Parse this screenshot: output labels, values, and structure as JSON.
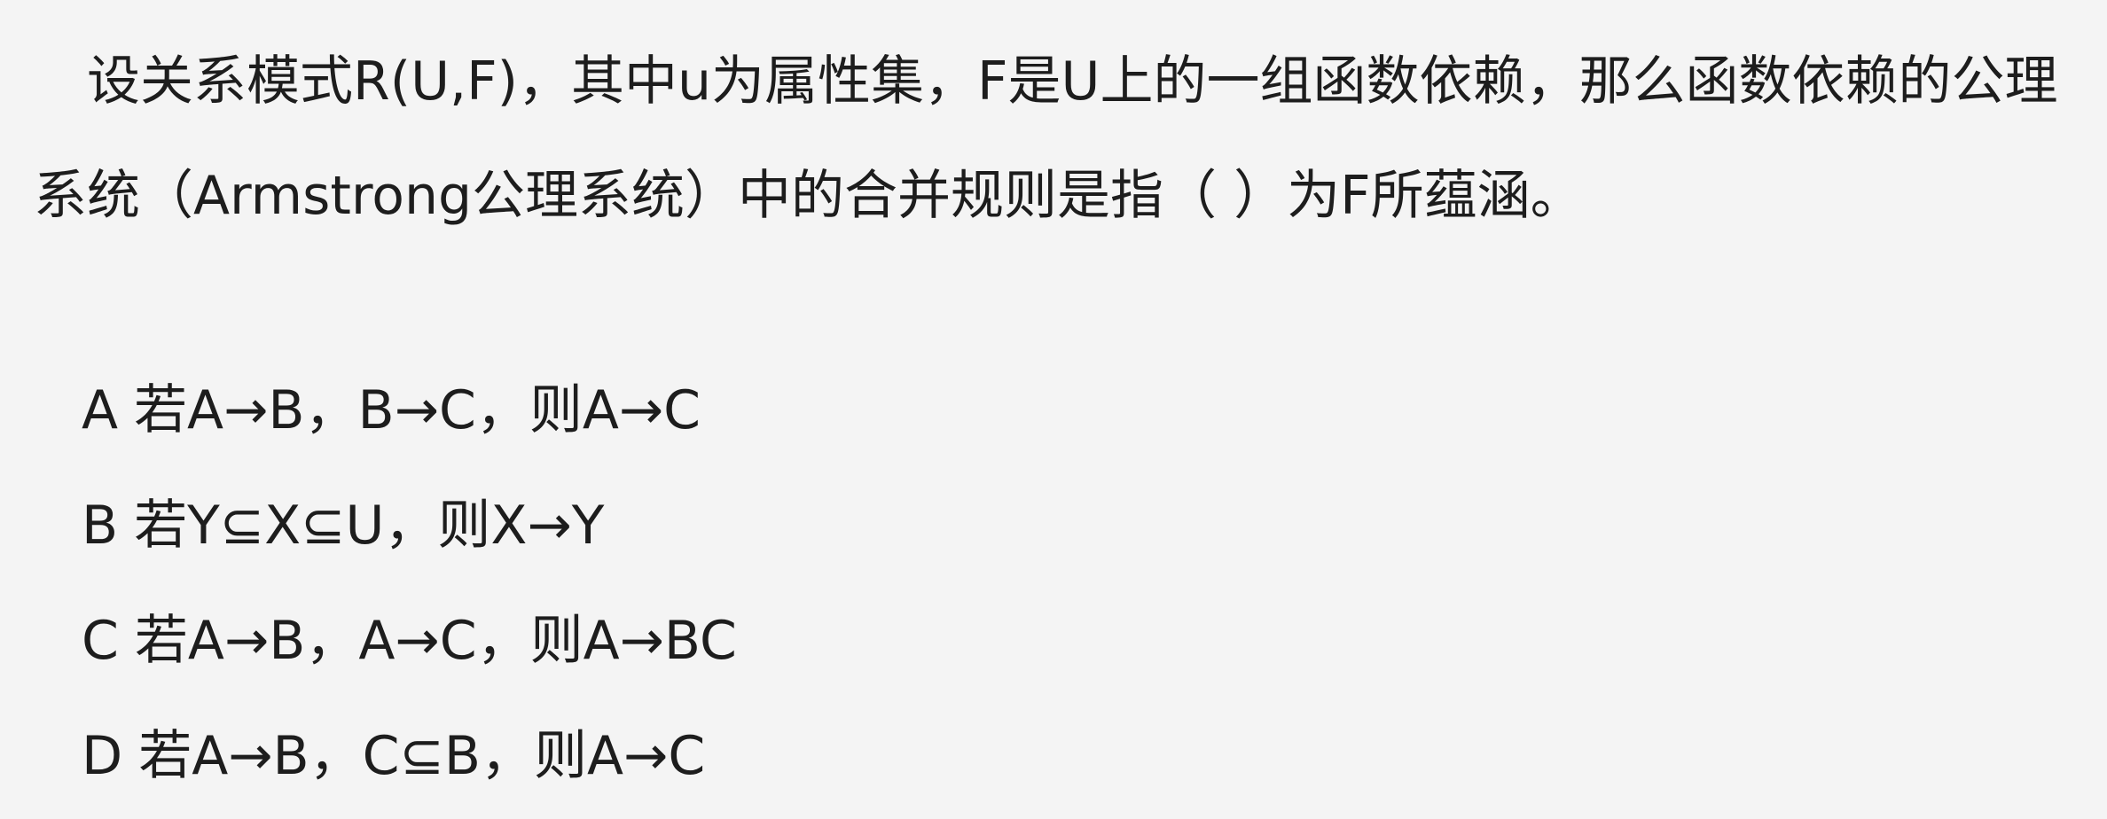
{
  "question": {
    "stem": "设关系模式R(U,F)，其中u为属性集，F是U上的一组函数依赖，那么函数依赖的公理系统（Armstrong公理系统）中的合并规则是指（ ）为F所蕴涵。"
  },
  "options": [
    {
      "letter": "A",
      "text": "若A→B，B→C，则A→C"
    },
    {
      "letter": "B",
      "text": "若Y⊆X⊆U，则X→Y"
    },
    {
      "letter": "C",
      "text": "若A→B，A→C，则A→BC"
    },
    {
      "letter": "D",
      "text": "若A→B，C⊆B，则A→C"
    }
  ]
}
